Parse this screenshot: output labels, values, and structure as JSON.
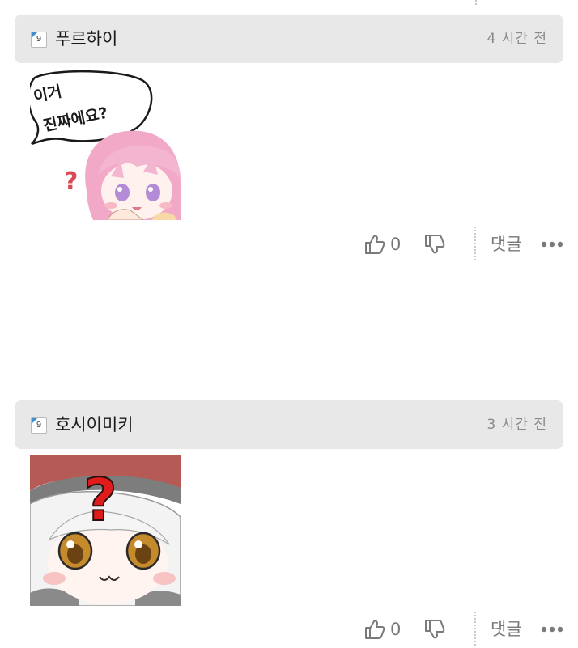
{
  "comments": [
    {
      "level": "9",
      "username": "푸르하이",
      "time": "4 시간 전",
      "sticker": {
        "icon": "pink-hair-girl-sticker",
        "speech_text_line1": "이거",
        "speech_text_line2": "진짜에요?",
        "mark": "?"
      },
      "likes": "0",
      "reply_label": "댓글"
    },
    {
      "level": "9",
      "username": "호시이미키",
      "time": "3 시간 전",
      "sticker": {
        "icon": "white-hair-girl-sticker",
        "mark": "?"
      },
      "likes": "0",
      "reply_label": "댓글"
    }
  ],
  "icons": {
    "like": "thumbs-up-icon",
    "dislike": "thumbs-down-icon",
    "more": "more-dots-icon",
    "level": "level-badge-icon"
  },
  "colors": {
    "header_bg": "#e8e8e8",
    "level_corner": "#3f8fd0",
    "question_mark": "#e01b1b",
    "muted_text": "#777777"
  }
}
